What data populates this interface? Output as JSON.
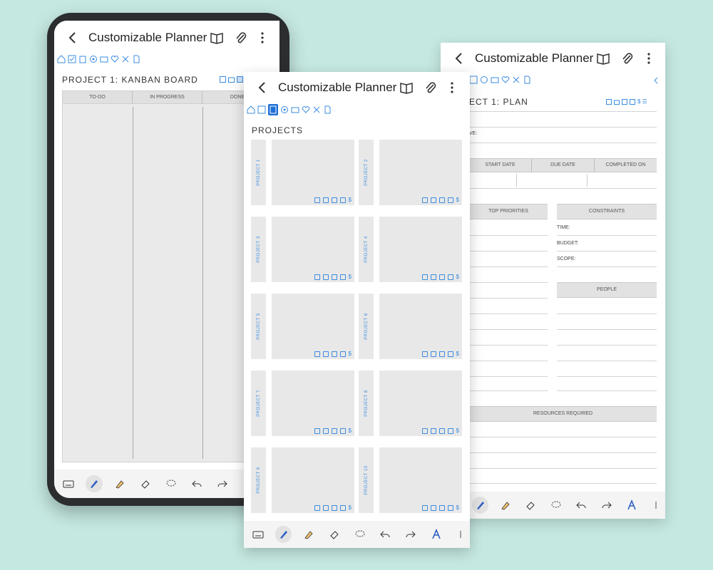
{
  "app": {
    "title": "Customizable Planner"
  },
  "phone": {
    "page_title": "PROJECT 1: KANBAN BOARD",
    "columns": [
      "TO-DO",
      "IN PROGRESS",
      "DONE"
    ]
  },
  "front": {
    "section_title": "PROJECTS",
    "projects": [
      "PROJECT 1",
      "PROJECT 2",
      "PROJECT 3",
      "PROJECT 4",
      "PROJECT 5",
      "PROJECT 6",
      "PROJECT 7",
      "PROJECT 8",
      "PROJECT 9",
      "PROJECT 10"
    ],
    "card_currency_symbol": "$"
  },
  "back": {
    "page_title": "ECT 1: PLAN",
    "objective_label": "VE:",
    "dates_headers": [
      "START DATE",
      "DUE DATE",
      "COMPLETED ON"
    ],
    "priorities_header": "TOP PRIORITIES",
    "constraints_header": "CONSTRAINTS",
    "constraints": [
      "TIME:",
      "BUDGET:",
      "SCOPE:"
    ],
    "people_header": "PEOPLE",
    "resources_header": "RESOURCES REQUIRED",
    "toolbar_extra": "$ ☰"
  },
  "colors": {
    "accent": "#3b8ce0",
    "active_nav": "#1f6fd6",
    "background": "#c5e8e1"
  }
}
